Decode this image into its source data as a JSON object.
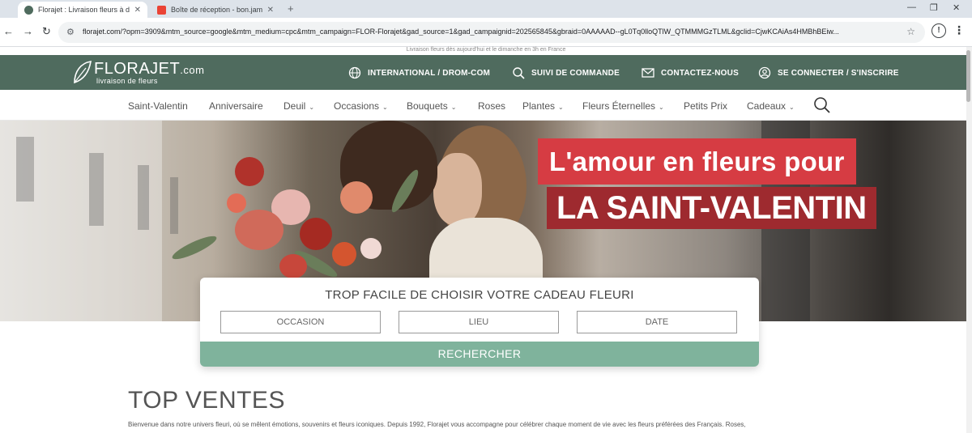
{
  "browser": {
    "tabs": [
      {
        "title": "Florajet : Livraison fleurs à dom",
        "active": true
      },
      {
        "title": "Boîte de réception - bon.james",
        "active": false
      }
    ],
    "url": "florajet.com/?opm=3909&mtm_source=google&mtm_medium=cpc&mtm_campaign=FLOR-Florajet&gad_source=1&gad_campaignid=202565845&gbraid=0AAAAAD--gL0Tq0lloQTlW_QTMMMGzTLML&gclid=CjwKCAiAs4HMBhBEiw..."
  },
  "site": {
    "top_note": "Livraison fleurs dès aujourd'hui et le dimanche en 3h en France",
    "logo": {
      "name": "FLORAJET",
      "suffix": ".com",
      "tagline": "livraison de fleurs"
    },
    "header_links": [
      {
        "label": "INTERNATIONAL / DROM-COM",
        "icon": "globe-icon"
      },
      {
        "label": "SUIVI DE COMMANDE",
        "icon": "tracking-icon"
      },
      {
        "label": "CONTACTEZ-NOUS",
        "icon": "mail-icon"
      },
      {
        "label": "SE CONNECTER / S'INSCRIRE",
        "icon": "user-icon"
      }
    ],
    "menu": [
      {
        "label": "Saint-Valentin",
        "dropdown": false
      },
      {
        "label": "Anniversaire",
        "dropdown": false
      },
      {
        "label": "Deuil",
        "dropdown": true
      },
      {
        "label": "Occasions",
        "dropdown": true
      },
      {
        "label": "Bouquets",
        "dropdown": true
      },
      {
        "label": "Roses",
        "dropdown": false
      },
      {
        "label": "Plantes",
        "dropdown": true
      },
      {
        "label": "Fleurs Éternelles",
        "dropdown": true
      },
      {
        "label": "Petits Prix",
        "dropdown": false
      },
      {
        "label": "Cadeaux",
        "dropdown": true
      }
    ],
    "hero": {
      "line1": "L'amour en fleurs pour",
      "line2": "LA SAINT-VALENTIN"
    },
    "finder": {
      "title": "TROP FACILE DE CHOISIR VOTRE CADEAU FLEURI",
      "fields": {
        "occasion": "OCCASION",
        "lieu": "LIEU",
        "date": "DATE"
      },
      "button": "RECHERCHER"
    },
    "top_sales": {
      "title": "TOP VENTES",
      "text": "Bienvenue dans notre univers fleuri, où se mêlent émotions, souvenirs et fleurs iconiques. Depuis 1992, Florajet vous accompagne pour célébrer chaque moment de vie avec les fleurs préférées des Français. Roses,"
    },
    "colors": {
      "brand_green": "#4f6b5e",
      "button_green": "#7fb39c",
      "hero_red": "#d63c43",
      "hero_dark_red": "#9e2a2f"
    }
  }
}
